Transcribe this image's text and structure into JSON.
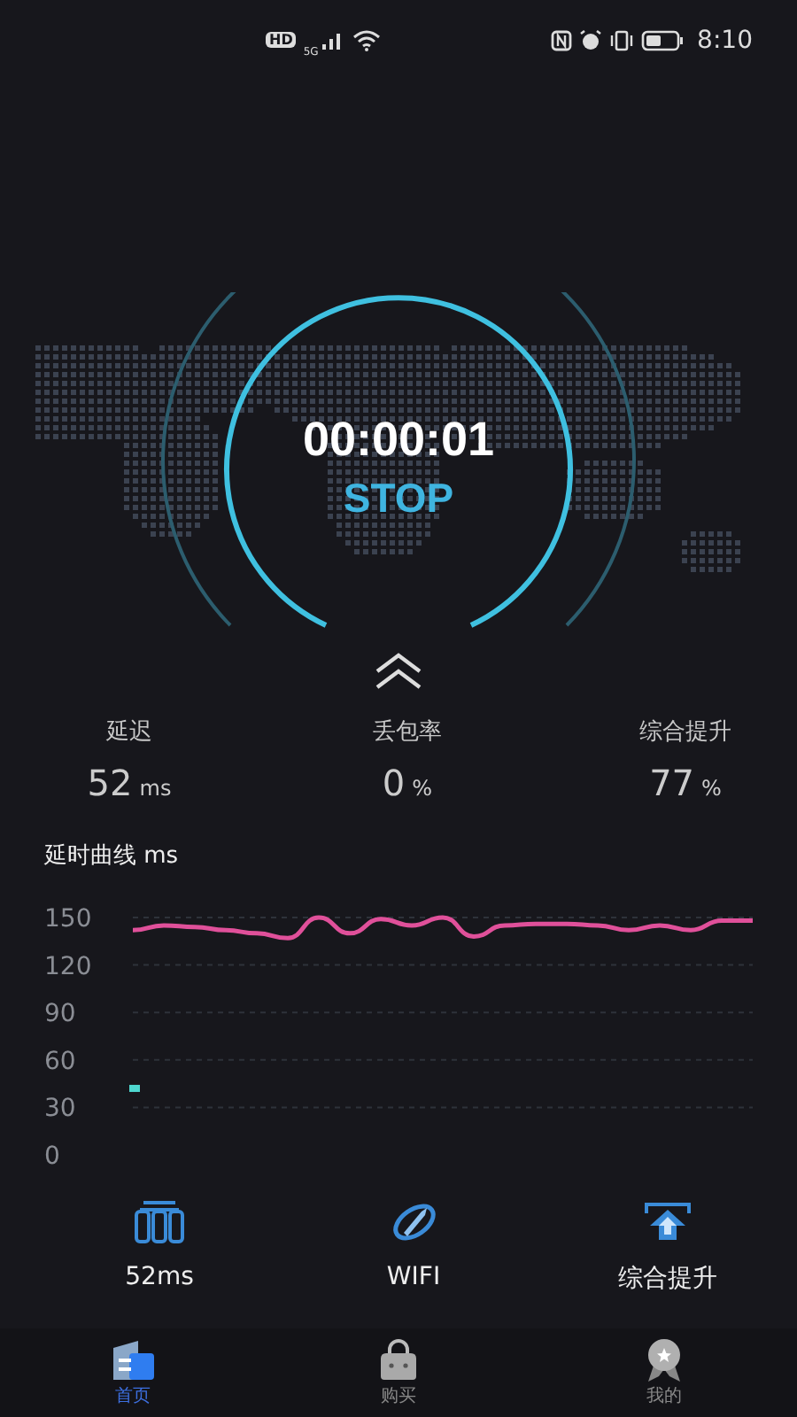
{
  "status_bar": {
    "badges": [
      "HD",
      "5G"
    ],
    "time": "8:10"
  },
  "timer": {
    "elapsed": "00:00:01",
    "action": "STOP"
  },
  "stats": [
    {
      "label": "延迟",
      "value": "52",
      "unit": "ms"
    },
    {
      "label": "丢包率",
      "value": "0",
      "unit": "%"
    },
    {
      "label": "综合提升",
      "value": "77",
      "unit": "%"
    }
  ],
  "latency_chart": {
    "title": "延时曲线 ms",
    "chart_data": {
      "type": "line",
      "grid": true,
      "ylim": [
        0,
        150
      ],
      "yticks": [
        0,
        30,
        60,
        90,
        120,
        150
      ],
      "series": [
        {
          "color": "#e0509a",
          "values": [
            142,
            145,
            144,
            142,
            140,
            137,
            150,
            140,
            149,
            145,
            150,
            138,
            145,
            146,
            146,
            145,
            142,
            145,
            142,
            148,
            148
          ]
        },
        {
          "color": "#4fd8d0",
          "marker": true,
          "values": [
            42,
            null,
            null,
            null,
            null,
            null,
            null,
            null,
            null,
            null,
            null,
            null,
            null,
            null,
            null,
            null,
            null,
            null,
            null,
            null,
            null
          ]
        }
      ]
    }
  },
  "shortcuts": [
    {
      "kind": "latency",
      "label": "52ms"
    },
    {
      "kind": "wifi",
      "label": "WIFI"
    },
    {
      "kind": "boost",
      "label": "综合提升"
    }
  ],
  "tabs": [
    {
      "kind": "home",
      "label": "首页",
      "selected": true
    },
    {
      "kind": "shop",
      "label": "购买",
      "selected": false
    },
    {
      "kind": "me",
      "label": "我的",
      "selected": false
    }
  ]
}
